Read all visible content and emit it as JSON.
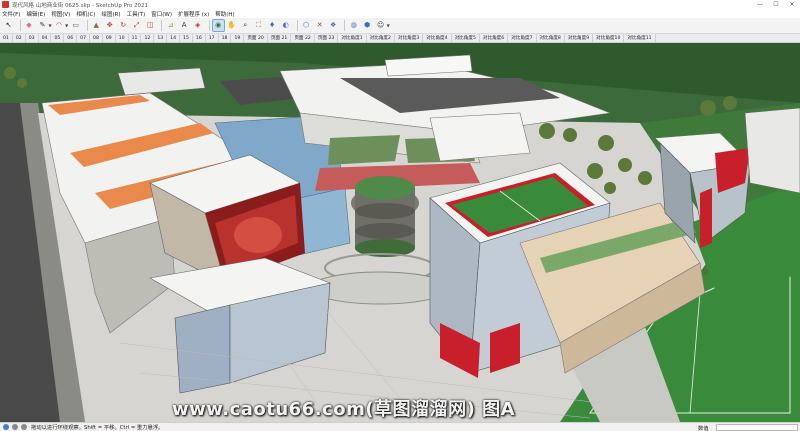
{
  "window": {
    "title": "现代风格 山地商业街 0625.skp - SketchUp Pro 2021",
    "controls": [
      "—",
      "☐",
      "✕"
    ]
  },
  "menu": [
    "文件(F)",
    "编辑(E)",
    "视图(V)",
    "相机(C)",
    "绘图(R)",
    "工具(T)",
    "窗口(W)",
    "扩展程序 (x)",
    "帮助(H)"
  ],
  "toolbar": {
    "tools": [
      {
        "name": "select-icon",
        "glyph": "↖",
        "color": "#222222"
      },
      {
        "name": "eraser-icon",
        "glyph": "◆",
        "color": "#e06a9a"
      },
      {
        "name": "pencil-icon",
        "glyph": "✎",
        "color": "#333333"
      },
      {
        "name": "arc-icon",
        "glyph": "◠",
        "color": "#c0392b"
      },
      {
        "name": "rectangle-icon",
        "glyph": "▭",
        "color": "#555555"
      },
      {
        "name": "push-pull-icon",
        "glyph": "▲",
        "color": "#8e6e3a"
      },
      {
        "name": "move-icon",
        "glyph": "✥",
        "color": "#c0392b"
      },
      {
        "name": "rotate-icon",
        "glyph": "↻",
        "color": "#c0392b"
      },
      {
        "name": "scale-icon",
        "glyph": "⤢",
        "color": "#c0392b"
      },
      {
        "name": "offset-icon",
        "glyph": "◫",
        "color": "#c0392b"
      },
      {
        "name": "tape-measure-icon",
        "glyph": "⊿",
        "color": "#b08a2a"
      },
      {
        "name": "text-icon",
        "glyph": "A",
        "color": "#333333"
      },
      {
        "name": "paint-bucket-icon",
        "glyph": "◈",
        "color": "#c0392b"
      },
      {
        "name": "orbit-icon",
        "glyph": "◉",
        "color": "#2e7d32"
      },
      {
        "name": "pan-icon",
        "glyph": "✋",
        "color": "#b07a3a"
      },
      {
        "name": "zoom-icon",
        "glyph": "⌕",
        "color": "#333333"
      },
      {
        "name": "zoom-extents-icon",
        "glyph": "⛶",
        "color": "#c0392b"
      },
      {
        "name": "walk-icon",
        "glyph": "♦",
        "color": "#3a6fc4"
      },
      {
        "name": "look-around-icon",
        "glyph": "◐",
        "color": "#3a6fc4"
      },
      {
        "name": "section-plane-icon",
        "glyph": "⬡",
        "color": "#3a6fc4"
      },
      {
        "name": "axes-icon",
        "glyph": "✕",
        "color": "#c0392b"
      },
      {
        "name": "component-icon",
        "glyph": "❖",
        "color": "#3a6fc4"
      },
      {
        "name": "warehouse-icon",
        "glyph": "◍",
        "color": "#3a6fc4"
      },
      {
        "name": "extension-icon",
        "glyph": "⬢",
        "color": "#3a6fc4"
      },
      {
        "name": "user-icon",
        "glyph": "☺",
        "color": "#444444"
      }
    ]
  },
  "scenes": [
    "01",
    "02",
    "03",
    "04",
    "05",
    "06",
    "07",
    "08",
    "09",
    "10",
    "11",
    "12",
    "13",
    "14",
    "15",
    "16",
    "17",
    "18",
    "19",
    "页面 20",
    "页面 21",
    "页面 22",
    "页面 23",
    "对比角度1",
    "对比角度2",
    "对比角度3",
    "对比角度4",
    "对比角度5",
    "对比角度6",
    "对比角度7",
    "对比角度8",
    "对比角度9",
    "对比角度10",
    "对比角度11"
  ],
  "watermark": "www.caotu66.com(草图溜溜网) 图A",
  "status": {
    "hint": "拖动以进行环绕观察。Shift = 平移。Ctrl = 重力悬浮。",
    "measure_label": "数值",
    "measure_value": ""
  },
  "colors": {
    "grass": "#3d6a3a",
    "plaza": "#d9d9d6",
    "orange_accent": "#e98a4c",
    "red_accent": "#c8202a",
    "glass": "#7fa8c9",
    "field": "#3a8a3c"
  }
}
